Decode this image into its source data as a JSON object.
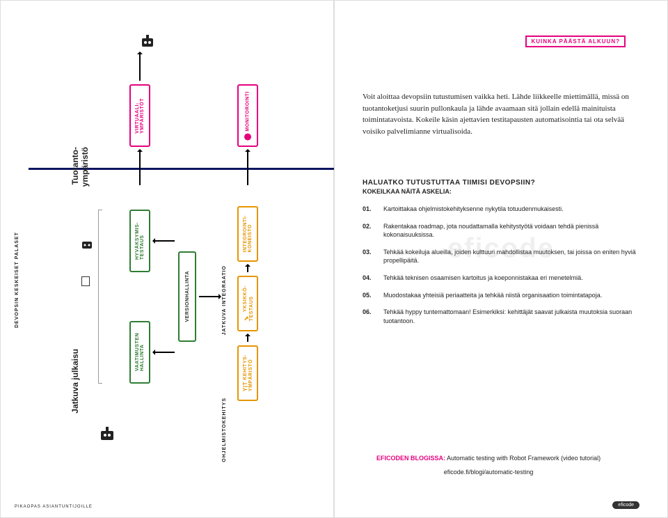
{
  "left": {
    "sidebar_tab": "DEVOPSIN KESKEISET PALASET",
    "footer": "PIKAOPAS ASIANTUNTIJOILLE",
    "env_prod_line1": "Tuotanto-",
    "env_prod_line2": "ympäristö",
    "env_ci_label": "Jatkuva julkaisu",
    "virt_env_l1": "VIRTUAALI-",
    "virt_env_l2": "YMPÄRISTÖT",
    "monitor": "MONITOROINTI",
    "accept_l1": "HYVÄKSYMIS-",
    "accept_l2": "TESTAUS",
    "version": "VERSIONHALLINTA",
    "req_l1": "VAATIMUSTEN",
    "req_l2": "HALLINTA",
    "jatkuva_integraatio": "JATKUVA INTEGRAATIO",
    "ohjelmisto": "OHJELMISTOKEHITYS",
    "integ_l1": "INTEGROINTI-",
    "integ_l2": "KONEISTO",
    "unit_l1": "YKSIKKÖ-",
    "unit_l2": "TESTAUS",
    "dev_l1": "KEHITYS-",
    "dev_l2": "YMPÄRISTÖ"
  },
  "right": {
    "header": "KUINKA PÄÄSTÄ ALKUUN?",
    "para": "Voit aloittaa devopsiin tutustumisen vaikka heti. Lähde liikkeelle miettimällä, missä on tuotantoketjusi suurin pullonkaula ja lähde avaamaan sitä jollain edellä mainituista toimintatavoista. Kokeile käsin ajettavien testitapausten automatisointia tai ota selvää voisiko palvelimianne virtualisoida.",
    "q_title": "HALUATKO TUTUSTUTTAA TIIMISI DEVOPSIIN?",
    "q_sub": "KOKEILKAA NÄITÄ ASKELIA:",
    "steps": [
      {
        "n": "01.",
        "t": "Kartoittakaa ohjelmistokehityksenne nykytila totuudenmukaisesti."
      },
      {
        "n": "02.",
        "t": "Rakentakaa roadmap, jota noudattamalla kehitystyötä voidaan tehdä pienissä kokonaisuuksissa."
      },
      {
        "n": "03.",
        "t": "Tehkää kokeiluja alueilla, joiden kulttuuri mahdollistaa muutoksen, tai joissa on eniten hyviä propellipäitä."
      },
      {
        "n": "04.",
        "t": "Tehkää teknisen osaamisen kartoitus ja koeponnistakaa eri menetelmiä."
      },
      {
        "n": "05.",
        "t": "Muodostakaa yhteisiä periaatteita ja tehkää niistä organisaation toimintatapoja."
      },
      {
        "n": "06.",
        "t": "Tehkää hyppy tuntemattomaan! Esimerkiksi: kehittäjät saavat julkaista muutoksia suoraan tuotantoon."
      }
    ],
    "blog_label": "EFICODEN BLOGISSA:",
    "blog_text": "Automatic testing with Robot Framework (video tutorial)",
    "blog_url": "eficode.fi/blogi/automatic-testing",
    "brand": "eficode",
    "watermark": "eficode"
  }
}
